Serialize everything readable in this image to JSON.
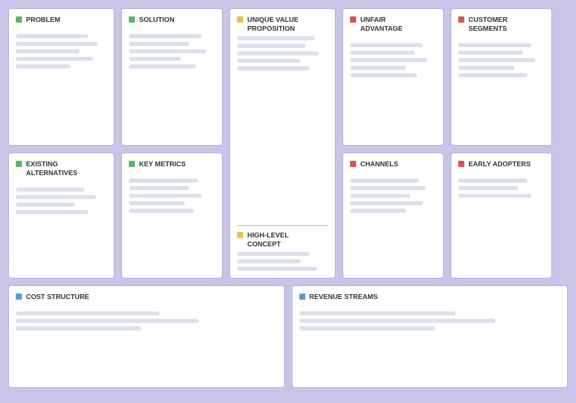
{
  "cards": {
    "problem": {
      "title": "PROBLEM",
      "dot": "green",
      "lines_top": [
        {
          "width": "80%"
        },
        {
          "width": "90%"
        },
        {
          "width": "70%"
        },
        {
          "width": "85%"
        },
        {
          "width": "60%"
        }
      ]
    },
    "existing_alternatives": {
      "title": "EXISTING\nALTERNATIVES",
      "dot": "green",
      "lines": [
        {
          "width": "75%"
        },
        {
          "width": "88%"
        },
        {
          "width": "65%"
        },
        {
          "width": "80%"
        }
      ]
    },
    "solution": {
      "title": "SOLUTION",
      "dot": "green",
      "lines": [
        {
          "width": "85%"
        },
        {
          "width": "70%"
        },
        {
          "width": "90%"
        },
        {
          "width": "60%"
        },
        {
          "width": "78%"
        }
      ]
    },
    "key_metrics": {
      "title": "KEY METRICS",
      "dot": "green",
      "lines": [
        {
          "width": "80%"
        },
        {
          "width": "70%"
        },
        {
          "width": "85%"
        },
        {
          "width": "65%"
        },
        {
          "width": "75%"
        }
      ]
    },
    "uvp": {
      "title": "UNIQUE VALUE\nPROPOSITION",
      "dot": "yellow",
      "lines_top": [
        {
          "width": "85%"
        },
        {
          "width": "75%"
        },
        {
          "width": "90%"
        },
        {
          "width": "70%"
        },
        {
          "width": "80%"
        }
      ]
    },
    "high_level_concept": {
      "title": "HIGH-LEVEL\nCONCEPT",
      "dot": "yellow",
      "lines": [
        {
          "width": "80%"
        },
        {
          "width": "70%"
        },
        {
          "width": "88%"
        }
      ]
    },
    "unfair_advantage": {
      "title": "UNFAIR\nADVANTAGE",
      "dot": "red",
      "lines": [
        {
          "width": "85%"
        },
        {
          "width": "75%"
        },
        {
          "width": "90%"
        },
        {
          "width": "65%"
        },
        {
          "width": "78%"
        }
      ]
    },
    "channels": {
      "title": "CHANNELS",
      "dot": "red",
      "lines": [
        {
          "width": "80%"
        },
        {
          "width": "88%"
        },
        {
          "width": "70%"
        },
        {
          "width": "85%"
        },
        {
          "width": "65%"
        }
      ]
    },
    "customer_segments": {
      "title": "CUSTOMER\nSEGMENTS",
      "dot": "red",
      "lines": [
        {
          "width": "85%"
        },
        {
          "width": "75%"
        },
        {
          "width": "90%"
        },
        {
          "width": "65%"
        },
        {
          "width": "80%"
        }
      ]
    },
    "early_adopters": {
      "title": "EARLY ADOPTERS",
      "dot": "red",
      "lines": [
        {
          "width": "80%"
        },
        {
          "width": "70%"
        },
        {
          "width": "85%"
        }
      ]
    },
    "cost_structure": {
      "title": "COST STRUCTURE",
      "dot": "blue",
      "lines": [
        {
          "width": "60%"
        },
        {
          "width": "75%"
        },
        {
          "width": "50%"
        }
      ]
    },
    "revenue_streams": {
      "title": "REVENUE STREAMS",
      "dot": "blue",
      "lines": [
        {
          "width": "65%"
        },
        {
          "width": "80%"
        },
        {
          "width": "55%"
        }
      ]
    }
  }
}
